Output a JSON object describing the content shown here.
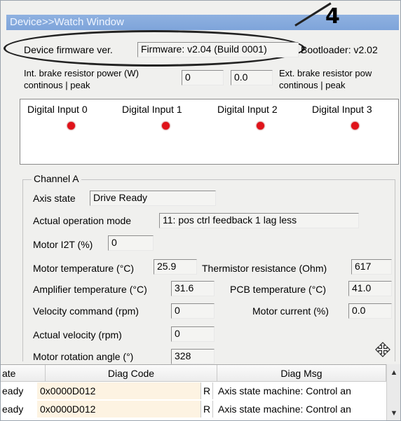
{
  "window": {
    "title": "Device>>Watch Window"
  },
  "callout": {
    "number": "4"
  },
  "firmware": {
    "label": "Device firmware ver.",
    "value": "Firmware: v2.04 (Build 0001)",
    "bootloader": "Bootloader: v2.02"
  },
  "brake": {
    "int_label_1": "Int. brake resistor power (W)",
    "int_label_2": "continous | peak",
    "int_continuous": "0",
    "int_peak": "0.0",
    "ext_label_1": "Ext. brake resistor pow",
    "ext_label_2": "continous | peak"
  },
  "digital_inputs": [
    {
      "label": "Digital Input 0",
      "state_color": "#e0131a"
    },
    {
      "label": "Digital Input 1",
      "state_color": "#e0131a"
    },
    {
      "label": "Digital Input 2",
      "state_color": "#e0131a"
    },
    {
      "label": "Digital Input 3",
      "state_color": "#e0131a"
    }
  ],
  "channel": {
    "title": "Channel A",
    "axis_state_label": "Axis state",
    "axis_state": "Drive Ready",
    "op_mode_label": "Actual operation mode",
    "op_mode": "11: pos ctrl feedback 1 lag less",
    "i2t_label": "Motor I2T (%)",
    "i2t": "0",
    "motor_temp_label": "Motor temperature (°C)",
    "motor_temp": "25.9",
    "thermistor_label": "Thermistor resistance (Ohm)",
    "thermistor": "617",
    "amp_temp_label": "Amplifier temperature (°C)",
    "amp_temp": "31.6",
    "pcb_temp_label": "PCB temperature (°C)",
    "pcb_temp": "41.0",
    "vel_cmd_label": "Velocity command (rpm)",
    "vel_cmd": "0",
    "motor_current_label": "Motor current (%)",
    "motor_current": "0.0",
    "actual_vel_label": "Actual velocity (rpm)",
    "actual_vel": "0",
    "rotation_label": "Motor rotation angle (°)",
    "rotation": "328"
  },
  "table": {
    "headers": [
      "ate",
      "Diag Code",
      "Diag Msg"
    ],
    "rows": [
      {
        "state": "eady",
        "code": "0x0000D012",
        "flag": "R",
        "msg": "Axis state machine: Control an"
      },
      {
        "state": "eady",
        "code": "0x0000D012",
        "flag": "R",
        "msg": "Axis state machine: Control an"
      }
    ]
  },
  "icons": {
    "move": "move-icon",
    "scroll_up": "scroll-up-icon",
    "scroll_down": "scroll-down-icon"
  }
}
